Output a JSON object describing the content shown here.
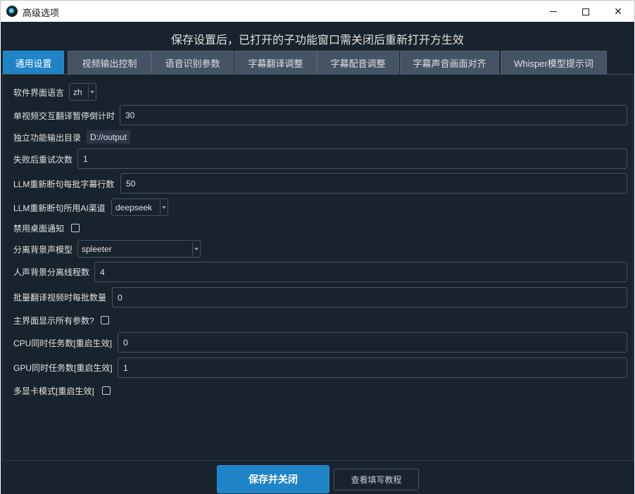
{
  "window": {
    "title": "高级选项",
    "minimize_glyph": "—",
    "close_glyph": "✕"
  },
  "notice": "保存设置后，已打开的子功能窗口需关闭后重新打开方生效",
  "tabs": [
    {
      "label": "通用设置",
      "active": true
    },
    {
      "label": "视频输出控制",
      "active": false
    },
    {
      "label": "语音识别参数",
      "active": false
    },
    {
      "label": "字幕翻译调整",
      "active": false
    },
    {
      "label": "字幕配音调整",
      "active": false
    },
    {
      "label": "字幕声音画面对齐",
      "active": false
    },
    {
      "label": "Whisper模型提示词",
      "active": false
    }
  ],
  "settings": {
    "ui_language": {
      "label": "软件界面语言",
      "value": "zh"
    },
    "countdown": {
      "label": "单视频交互翻译暂停倒计时",
      "value": "30"
    },
    "output_dir": {
      "label": "独立功能输出目录",
      "value": "D://output"
    },
    "retry": {
      "label": "失败后重试次数",
      "value": "1"
    },
    "llm_batch": {
      "label": "LLM重新断句每批字幕行数",
      "value": "50"
    },
    "llm_channel": {
      "label": "LLM重新断句所用AI渠道",
      "value": "deepseek"
    },
    "disable_notify": {
      "label": "禁用桌面通知",
      "checked": false
    },
    "sep_model": {
      "label": "分离背景声模型",
      "value": "spleeter"
    },
    "sep_threads": {
      "label": "人声背景分离线程数",
      "value": "4"
    },
    "batch_count": {
      "label": "批量翻译视频时每批数量",
      "value": "0"
    },
    "show_all": {
      "label": "主界面显示所有参数?",
      "checked": false
    },
    "cpu_tasks": {
      "label": "CPU同时任务数[重启生效]",
      "value": "0"
    },
    "gpu_tasks": {
      "label": "GPU同时任务数[重启生效]",
      "value": "1"
    },
    "multi_gpu": {
      "label": "多显卡模式[重启生效]",
      "checked": false
    }
  },
  "buttons": {
    "save": "保存并关闭",
    "help": "查看填写教程"
  },
  "colors": {
    "background": "#19232d",
    "accent": "#1f83c8",
    "tab": "#455364",
    "text": "#e0e1e3"
  }
}
